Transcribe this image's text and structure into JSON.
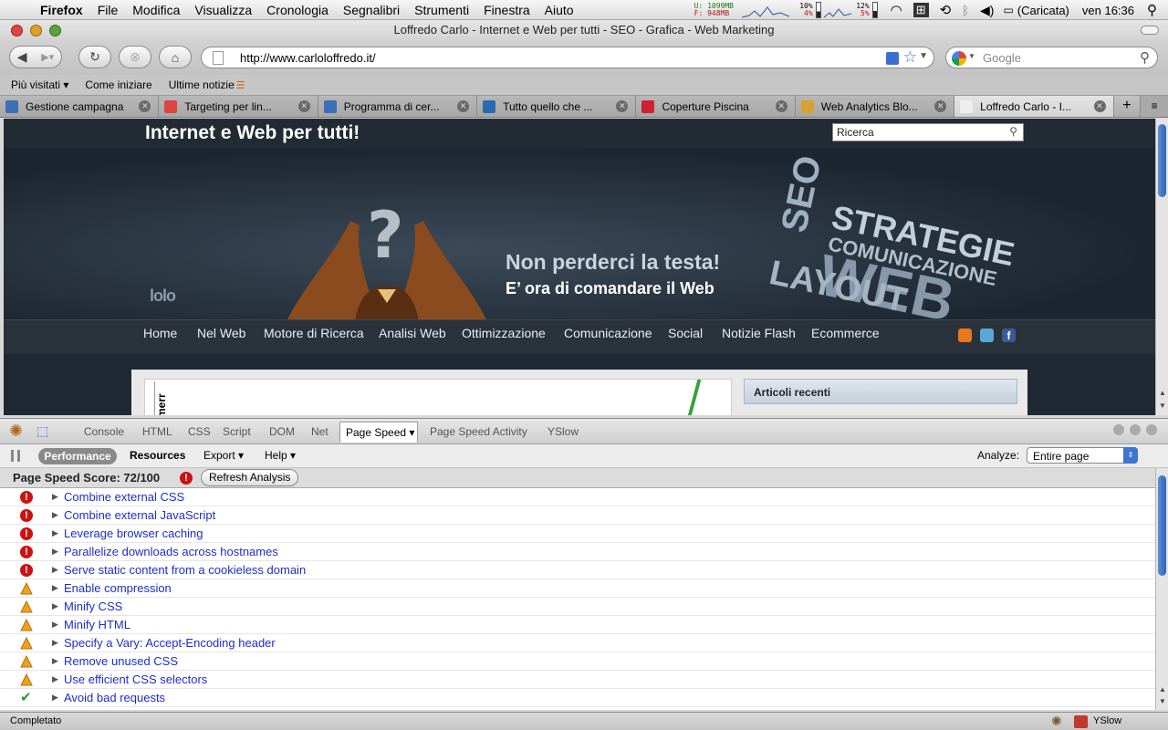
{
  "menubar": {
    "app_name": "Firefox",
    "items": [
      "File",
      "Modifica",
      "Visualizza",
      "Cronologia",
      "Segnalibri",
      "Strumenti",
      "Finestra",
      "Aiuto"
    ],
    "net_up": "U: 1099MB",
    "net_down": "F:  948MB",
    "cpu1": "10%",
    "cpu1b": "4%",
    "cpu2": "12%",
    "cpu2b": "5%",
    "battery": "(Caricata)",
    "clock": "ven 16:36"
  },
  "window": {
    "title": "Loffredo Carlo - Internet e Web per tutti - SEO - Grafica - Web Marketing"
  },
  "toolbar": {
    "url": "http://www.carloloffredo.it/",
    "search_placeholder": "Google"
  },
  "bookmarks": [
    {
      "label": "Più visitati ▾"
    },
    {
      "label": "Come iniziare"
    },
    {
      "label": "Ultime notizie"
    }
  ],
  "tabs": [
    {
      "label": "Gestione campagna",
      "fav": "#3d6fb8",
      "active": false
    },
    {
      "label": "Targeting per lin...",
      "fav": "#d44",
      "active": false
    },
    {
      "label": "Programma di cer...",
      "fav": "#3d6fb8",
      "active": false
    },
    {
      "label": "Tutto quello che ...",
      "fav": "#2a6bb0",
      "active": false
    },
    {
      "label": "Coperture Piscina",
      "fav": "#c23",
      "active": false
    },
    {
      "label": "Web Analytics Blo...",
      "fav": "#d9a030",
      "active": false
    },
    {
      "label": "Loffredo Carlo - I...",
      "fav": "#eee",
      "active": true
    }
  ],
  "site": {
    "title": "Internet e Web per tutti!",
    "search_value": "Ricerca",
    "slogan1": "Non perderci la testa!",
    "slogan2": "E’ ora di comandare il Web",
    "logo": "lolo",
    "cloud_words": [
      "SEO",
      "STRATEGIE",
      "COMUNICAZIONE",
      "WEB",
      "LAYOUT"
    ],
    "nav": [
      "Home",
      "Nel Web",
      "Motore di Ricerca",
      "Analisi Web",
      "Ottimizzazione",
      "Comunicazione",
      "Social",
      "Notizie Flash",
      "Ecommerce"
    ],
    "sidebar_title": "Articoli recenti",
    "content_snippet": "merr"
  },
  "firebug": {
    "tabs": [
      "Console",
      "HTML",
      "CSS",
      "Script",
      "DOM",
      "Net",
      "Page Speed ▾",
      "Page Speed Activity",
      "YSlow"
    ],
    "active_tab": "Page Speed ▾",
    "subtabs": [
      "Performance",
      "Resources",
      "Export ▾",
      "Help ▾"
    ],
    "analyze_label": "Analyze:",
    "analyze_value": "Entire page",
    "score_text": "Page Speed Score: 72/100",
    "refresh_label": "Refresh Analysis",
    "rules": [
      {
        "label": "Combine external CSS",
        "status": "error"
      },
      {
        "label": "Combine external JavaScript",
        "status": "error"
      },
      {
        "label": "Leverage browser caching",
        "status": "error"
      },
      {
        "label": "Parallelize downloads across hostnames",
        "status": "error"
      },
      {
        "label": "Serve static content from a cookieless domain",
        "status": "error"
      },
      {
        "label": "Enable compression",
        "status": "warning"
      },
      {
        "label": "Minify CSS",
        "status": "warning"
      },
      {
        "label": "Minify HTML",
        "status": "warning"
      },
      {
        "label": "Specify a Vary: Accept-Encoding header",
        "status": "warning"
      },
      {
        "label": "Remove unused CSS",
        "status": "warning"
      },
      {
        "label": "Use efficient CSS selectors",
        "status": "warning"
      },
      {
        "label": "Avoid bad requests",
        "status": "ok"
      }
    ]
  },
  "statusbar": {
    "text": "Completato",
    "yslow": "YSlow"
  },
  "colors": {
    "error": "#cc1111",
    "warning": "#f0a020",
    "ok": "#2a9a2a",
    "link": "#1c2ec8"
  }
}
